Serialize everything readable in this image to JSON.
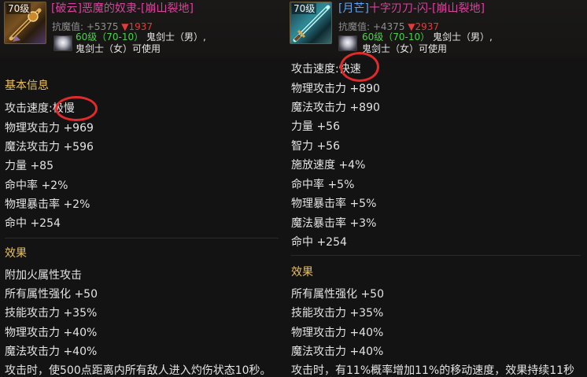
{
  "left_item": {
    "level_badge": "70级",
    "name_prefix": "[破云]",
    "name": "恶魔的奴隶-[崩山裂地]",
    "anti_magic_label": "抗魔值: +5375",
    "anti_magic_delta": "▼1937",
    "req_level": "60级（70-10）",
    "req_class_1": "鬼剑士（男）,",
    "req_class_2": "鬼剑士（女）可使用",
    "basic_info_title": "基本信息",
    "attack_speed_label": "攻击速度:",
    "attack_speed_value": "极慢",
    "stats": [
      "物理攻击力 +969",
      "魔法攻击力 +596",
      "力量 +85",
      "命中率 +2%",
      "物理暴击率 +2%",
      "命中 +254"
    ],
    "effect_title": "效果",
    "effects": [
      "附加火属性攻击",
      "所有属性强化 +50",
      "技能攻击力 +35%",
      "物理攻击力 +40%",
      "魔法攻击力 +40%",
      "攻击时，使500点距离内所有敌人进入灼伤状态10秒。"
    ]
  },
  "right_item": {
    "level_badge": "70级",
    "name_prefix": "[月芒]",
    "name": "十字刃刀-闪-[崩山裂地]",
    "anti_magic_label": "抗魔值: +4375",
    "anti_magic_delta": "▼2937",
    "req_level": "60级（70-10）",
    "req_class_1": "鬼剑士（男）,",
    "req_class_2": "鬼剑士（女）可使用",
    "attack_speed_label": "攻击速度:",
    "attack_speed_value": "快速",
    "stats": [
      "物理攻击力 +890",
      "魔法攻击力 +890",
      "力量 +56",
      "智力 +56",
      "施放速度 +4%",
      "命中率 +5%",
      "物理暴击率 +5%",
      "魔法暴击率 +3%",
      "命中 +254"
    ],
    "effect_title": "效果",
    "effects": [
      "所有属性强化 +50",
      "技能攻击力 +35%",
      "物理攻击力 +40%",
      "魔法攻击力 +40%",
      "攻击时，有11%概率增加11%的移动速度，效果持续11秒"
    ]
  },
  "colors": {
    "name_pink": "#d8439b",
    "moon_prefix_blue": "#59a6ff",
    "section_gold": "#e8c15a",
    "level_green": "#47d447",
    "delta_red": "#e23b3b",
    "circle_red": "#e12a2a"
  }
}
